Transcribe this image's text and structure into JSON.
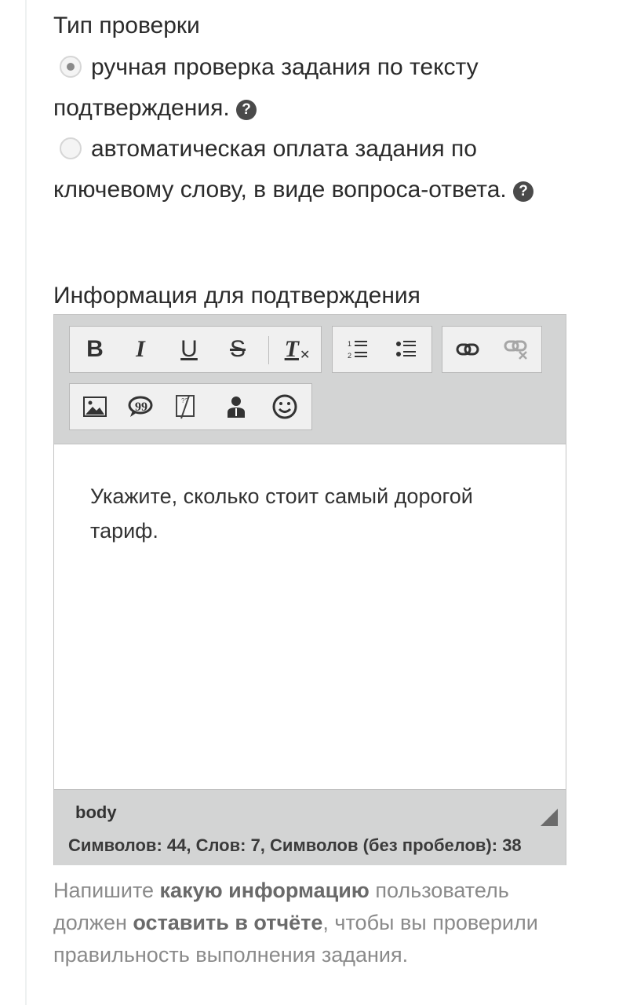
{
  "check_type": {
    "label": "Тип проверки",
    "options": [
      {
        "text": "ручная проверка задания по тексту подтверждения.",
        "selected": true
      },
      {
        "text": "автоматическая оплата задания по ключевому слову, в виде вопроса-ответа.",
        "selected": false
      }
    ],
    "help_glyph": "?"
  },
  "confirmation": {
    "label": "Информация для подтверждения",
    "toolbar": {
      "bold": "B",
      "italic": "I",
      "underline": "U",
      "strike": "S",
      "remove_format": "T",
      "icons": [
        "bold-icon",
        "italic-icon",
        "underline-icon",
        "strikethrough-icon",
        "remove-format-icon",
        "numbered-list-icon",
        "bulleted-list-icon",
        "link-icon",
        "unlink-icon",
        "image-icon",
        "blockquote-icon",
        "spoiler-icon",
        "user-icon",
        "smiley-icon"
      ]
    },
    "content": "Укажите, сколько стоит самый дорогой тариф.",
    "footer": {
      "path": "body",
      "stats": "Символов: 44, Слов: 7, Символов (без пробелов): 38"
    }
  },
  "hint": {
    "p1": "Напишите ",
    "b1": "какую информацию",
    "p2": " пользователь должен ",
    "b2": "оставить в отчёте",
    "p3": ", чтобы вы проверили правильность выполнения задания."
  }
}
